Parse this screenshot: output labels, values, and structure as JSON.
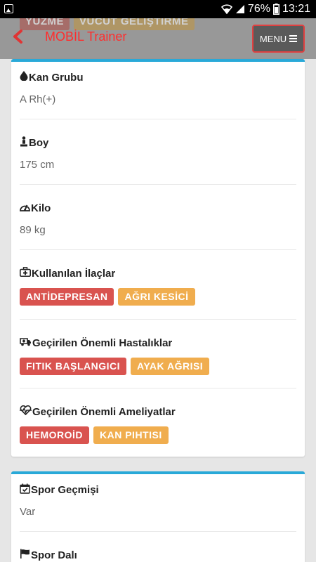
{
  "status_bar": {
    "battery_percent": "76%",
    "time": "13:21",
    "icons": [
      "image-icon",
      "wifi-icon",
      "signal-icon",
      "battery-icon"
    ]
  },
  "header": {
    "title": "MOBİL Trainer",
    "menu_label": "MENU",
    "behind_tags": [
      "YÜZME",
      "VÜCUT GELİŞTİRME"
    ]
  },
  "health": {
    "blood_type": {
      "label": "Kan Grubu",
      "value": "A Rh(+)"
    },
    "height": {
      "label": "Boy",
      "value": "175 cm"
    },
    "weight": {
      "label": "Kilo",
      "value": "89 kg"
    },
    "medications": {
      "label": "Kullanılan İlaçlar",
      "tags": [
        "ANTİDEPRESAN",
        "AĞRI KESİCİ"
      ]
    },
    "illnesses": {
      "label": "Geçirilen Önemli Hastalıklar",
      "tags": [
        "FITIK BAŞLANGICI",
        "AYAK AĞRISI"
      ]
    },
    "surgeries": {
      "label": "Geçirilen Önemli Ameliyatlar",
      "tags": [
        "HEMOROİD",
        "KAN PIHTISI"
      ]
    }
  },
  "sport": {
    "history": {
      "label": "Spor Geçmişi",
      "value": "Var"
    },
    "branch": {
      "label": "Spor Dalı"
    }
  },
  "colors": {
    "accent_blue": "#29a9d8",
    "badge_red": "#d9534f",
    "badge_orange": "#f0ad4e",
    "title_red": "#ff2d2d"
  }
}
